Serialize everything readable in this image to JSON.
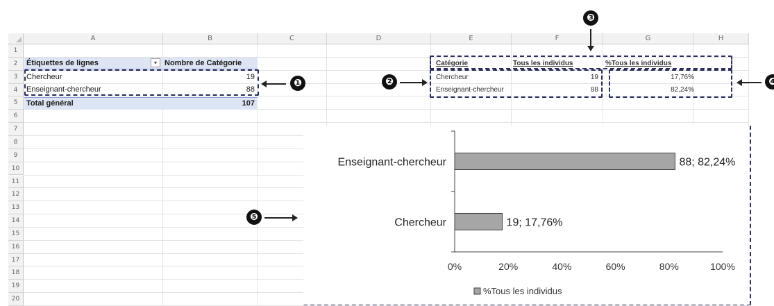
{
  "sheet": {
    "columns": [
      "A",
      "B",
      "C",
      "D",
      "E",
      "F",
      "G",
      "H"
    ],
    "rows": [
      "1",
      "2",
      "3",
      "4",
      "5",
      "6",
      "7",
      "8",
      "9",
      "10",
      "11",
      "12",
      "13",
      "14",
      "15",
      "16",
      "17",
      "18",
      "19",
      "20"
    ]
  },
  "pivot": {
    "header_label": "Étiquettes de lignes",
    "header_value": "Nombre de Catégorie",
    "rows": [
      {
        "label": "Chercheur",
        "value": "19"
      },
      {
        "label": "Enseignant-chercheur",
        "value": "88"
      }
    ],
    "total_label": "Total général",
    "total_value": "107"
  },
  "summary_table": {
    "col_category": "Catégorie",
    "col_all": "Tous les individus",
    "col_pct": "%Tous les individus",
    "rows": [
      {
        "category": "Chercheur",
        "all": "19",
        "pct": "17,76%"
      },
      {
        "category": "Enseignant-chercheur",
        "all": "88",
        "pct": "82,24%"
      }
    ]
  },
  "callouts": {
    "one": "❶",
    "two": "❷",
    "three": "❸",
    "four": "❹",
    "five": "❺"
  },
  "colors": {
    "bar_fill": "#a6a6a6",
    "bar_stroke": "#404040",
    "annotation": "#2b2f5e",
    "pivot_header": "#dde4f3"
  },
  "chart_data": {
    "type": "bar",
    "orientation": "horizontal",
    "categories": [
      "Enseignant-chercheur",
      "Chercheur"
    ],
    "series": [
      {
        "name": "%Tous les individus",
        "values": [
          82.24,
          17.76
        ]
      }
    ],
    "data_labels": [
      "88; 82,24%",
      "19; 17,76%"
    ],
    "x_ticks": [
      "0%",
      "20%",
      "40%",
      "60%",
      "80%",
      "100%"
    ],
    "xlim": [
      0,
      100
    ],
    "legend_position": "bottom",
    "grid": false
  }
}
